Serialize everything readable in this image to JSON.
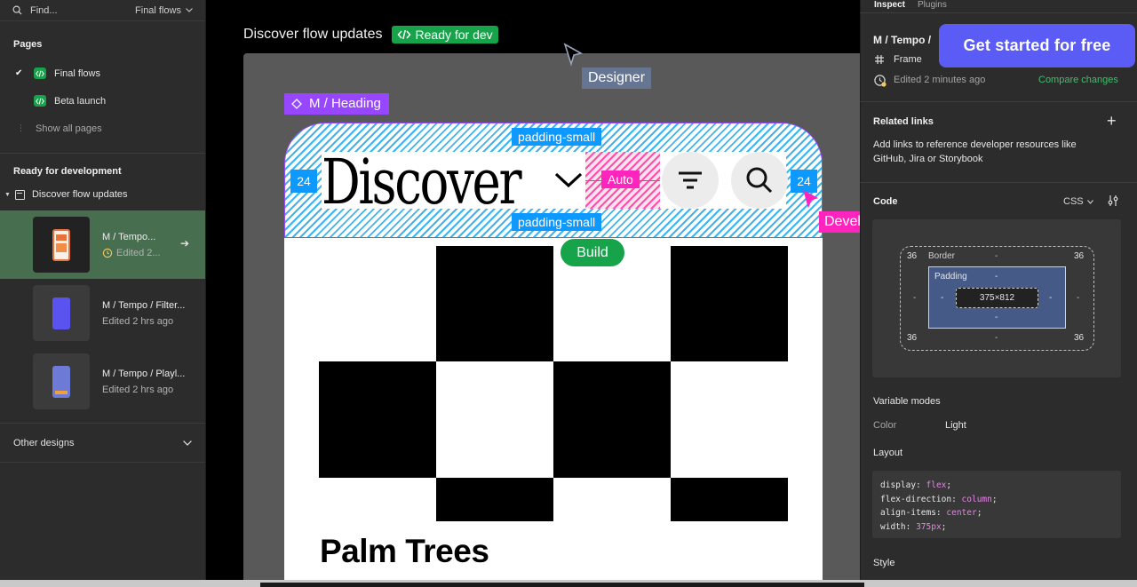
{
  "left": {
    "search_placeholder": "Find...",
    "flows_label": "Final flows",
    "pages_title": "Pages",
    "pages": [
      {
        "label": "Final flows",
        "checked": true
      },
      {
        "label": "Beta launch",
        "checked": false
      }
    ],
    "show_all": "Show all pages",
    "ready_title": "Ready for development",
    "tree_item": "Discover flow updates",
    "frames": [
      {
        "name": "M / Tempo...",
        "time": "Edited 2...",
        "selected": true,
        "phone_color": "#e6743a"
      },
      {
        "name": "M / Tempo / Filter...",
        "time": "Edited 2 hrs ago",
        "selected": false,
        "phone_color": "#5b53f0"
      },
      {
        "name": "M / Tempo / Playl...",
        "time": "Edited 2 hrs ago",
        "selected": false,
        "phone_color": "#6e7bd6"
      }
    ],
    "other_designs": "Other designs"
  },
  "canvas": {
    "title": "Discover flow updates",
    "status": "Ready for dev",
    "component_tag": "M / Heading",
    "heading_text": "Discover",
    "padding_top": "padding-small",
    "padding_bottom": "padding-small",
    "auto_label": "Auto",
    "left_spacing": "24",
    "right_spacing": "24",
    "build_label": "Build",
    "designer_label": "Designer",
    "developer_label": "Developer",
    "content_title": "Palm Trees",
    "colors": {
      "accent_purple": "#9747ff",
      "accent_blue": "#0d99ff",
      "accent_pink": "#ff24bd",
      "green": "#16a34a"
    }
  },
  "right": {
    "tab_inspect": "Inspect",
    "tab_plugins": "Plugins",
    "frame_name": "M / Tempo /",
    "frame_type": "Frame",
    "edited": "Edited 2 minutes ago",
    "compare": "Compare changes",
    "cta": "Get started for free",
    "related_title": "Related links",
    "related_desc_1": "Add links to reference developer resources like",
    "related_desc_2": "GitHub, Jira or Storybook",
    "code_title": "Code",
    "code_lang": "CSS",
    "box": {
      "border_label": "Border",
      "padding_label": "Padding",
      "size": "375×812",
      "tl": "36",
      "tr": "36",
      "bl": "36",
      "br": "36",
      "dash": "-"
    },
    "variable_modes": "Variable modes",
    "var_color_label": "Color",
    "var_color_value": "Light",
    "layout_title": "Layout",
    "layout_code": [
      {
        "prop": "display",
        "val": "flex"
      },
      {
        "prop": "flex-direction",
        "val": "column"
      },
      {
        "prop": "align-items",
        "val": "center"
      },
      {
        "prop": "width",
        "val": "375px"
      }
    ],
    "style_title": "Style"
  }
}
